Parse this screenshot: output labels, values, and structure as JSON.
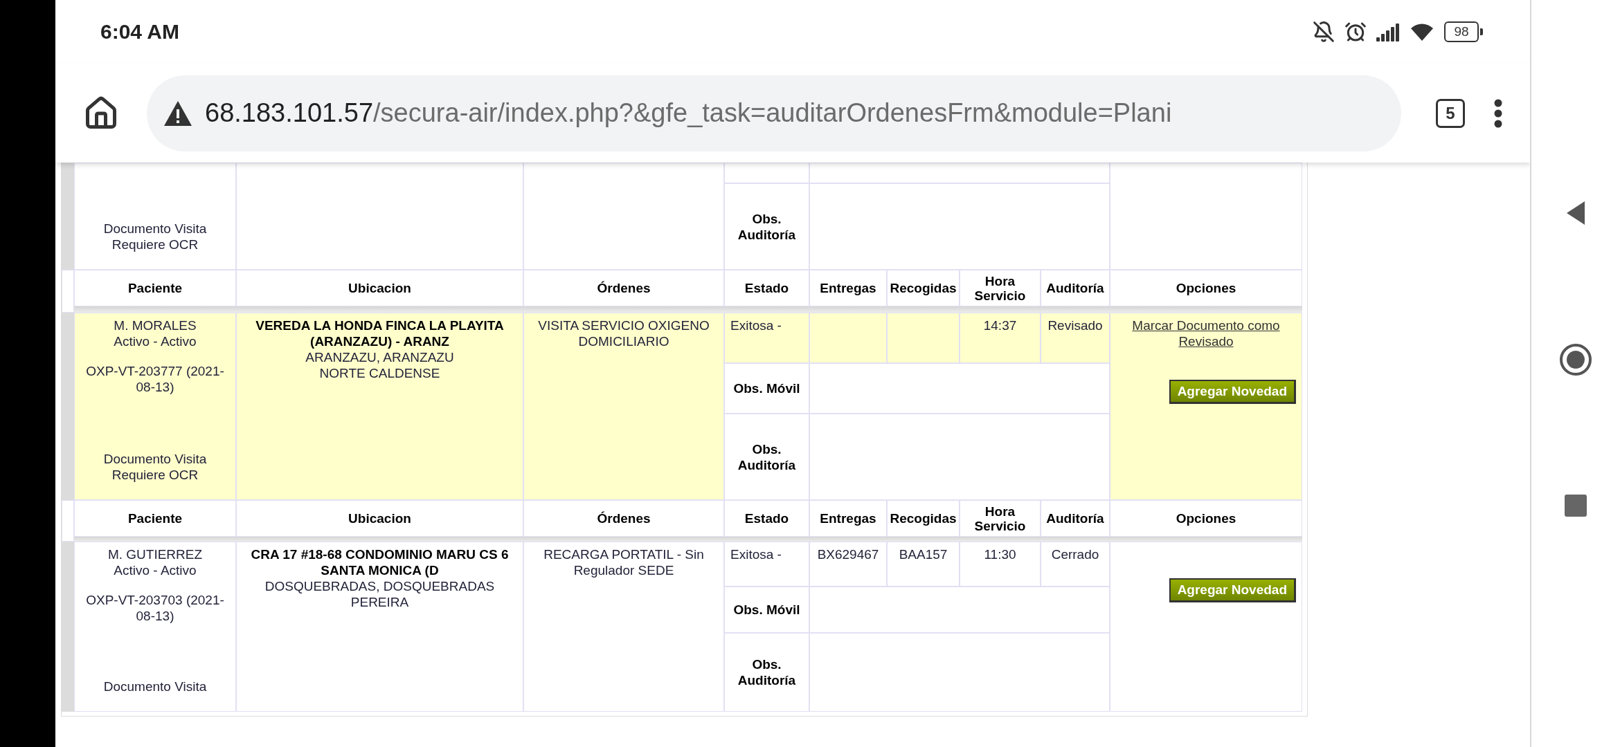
{
  "status_bar": {
    "time": "6:04 AM",
    "battery": "98"
  },
  "browser": {
    "url_host": "68.183.101.57",
    "url_path": "/secura-air/index.php?&gfe_task=auditarOrdenesFrm&module=Plani",
    "tab_count": "5"
  },
  "previous_record": {
    "document_note": "Documento Visita Requiere OCR",
    "obs_auditoria_label": "Obs. Auditoría"
  },
  "records": [
    {
      "highlighted": true,
      "header": [
        "Paciente",
        "Ubicacion",
        "Órdenes",
        "Estado",
        "Entregas",
        "Recogidas",
        "Hora Servicio",
        "Auditoría",
        "Opciones"
      ],
      "patient": {
        "name": "M. MORALES",
        "status": "Activo - Activo",
        "order": "OXP-VT-203777 (2021-08-13)",
        "document_note": "Documento Visita Requiere OCR"
      },
      "location": {
        "address": "VEREDA LA HONDA FINCA LA PLAYITA (ARANZAZU) - ARANZ",
        "city": "ARANZAZU, ARANZAZU",
        "region": "NORTE CALDENSE"
      },
      "orders": "VISITA SERVICIO OXIGENO DOMICILIARIO",
      "estado": "Exitosa -",
      "hora": "14:37",
      "auditoria": "Revisado",
      "obs_movil_label": "Obs. Móvil",
      "obs_auditoria_label": "Obs. Auditoría",
      "link": "Marcar Documento como Revisado",
      "button": "Agregar Novedad"
    },
    {
      "highlighted": false,
      "header": [
        "Paciente",
        "Ubicacion",
        "Órdenes",
        "Estado",
        "Entregas",
        "Recogidas",
        "Hora Servicio",
        "Auditoría",
        "Opciones"
      ],
      "patient": {
        "name": "M. GUTIERREZ",
        "status": "Activo - Activo",
        "order": "OXP-VT-203703 (2021-08-13)",
        "document_note": "Documento Visita"
      },
      "location": {
        "address": "CRA 17 #18-68 CONDOMINIO MARU CS 6 SANTA MONICA (D",
        "city": "DOSQUEBRADAS, DOSQUEBRADAS",
        "region": "PEREIRA"
      },
      "orders": "RECARGA PORTATIL - Sin Regulador SEDE",
      "estado": "Exitosa -",
      "entregas": "BX629467",
      "recogidas": "BAA157",
      "hora": "11:30",
      "auditoria": "Cerrado",
      "obs_movil_label": "Obs. Móvil",
      "obs_auditoria_label": "Obs. Auditoría",
      "button": "Agregar Novedad"
    }
  ]
}
